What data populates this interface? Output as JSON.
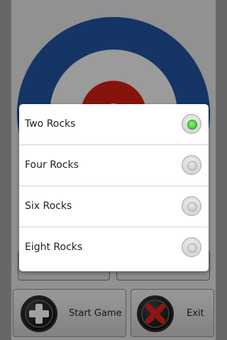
{
  "background_screen": {
    "start_button_label": "Start Game",
    "exit_button_label": "Exit"
  },
  "dialog": {
    "options": [
      {
        "label": "Two Rocks",
        "checked": true
      },
      {
        "label": "Four Rocks",
        "checked": false
      },
      {
        "label": "Six Rocks",
        "checked": false
      },
      {
        "label": "Eight Rocks",
        "checked": false
      }
    ]
  },
  "colors": {
    "house_outer": "#1f4f97",
    "house_middle": "#e8e8e8",
    "house_center": "#c91f12",
    "radio_selected": "#22c413"
  }
}
